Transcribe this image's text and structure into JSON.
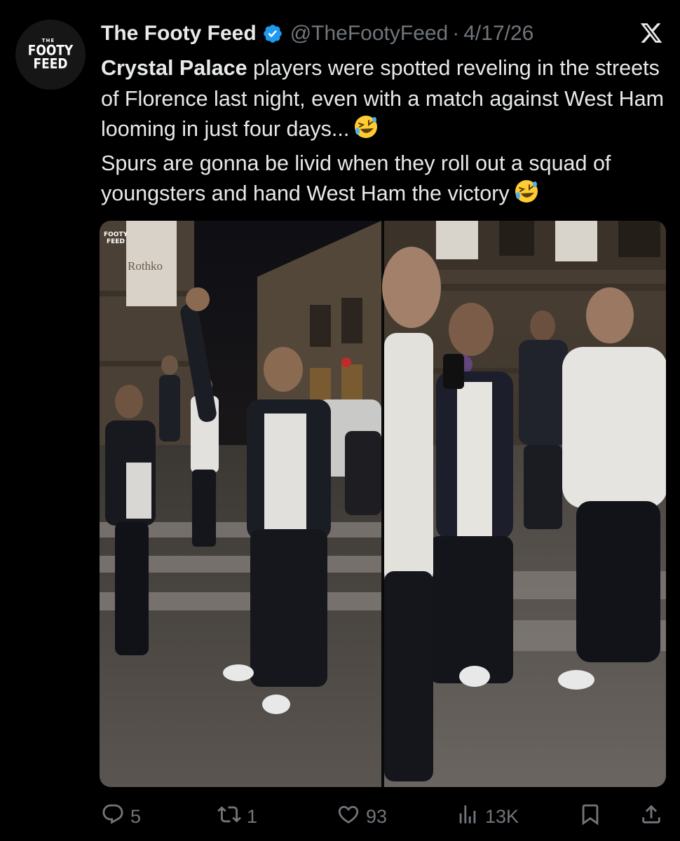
{
  "tweet": {
    "author_name": "The Footy Feed",
    "handle": "@TheFootyFeed",
    "separator": "·",
    "date": "4/17/26",
    "text_bold": "Crystal Palace",
    "text_lines": [
      " players were spotted reveling in the streets of Florence last night, even with a match against West Ham looming in just four days...",
      "Spurs are gonna be livid when they roll out a squad of youngsters and hand West Ham the victory"
    ]
  },
  "avatar": {
    "the": "THE",
    "line1": "FOOTY",
    "line2": "FEED"
  },
  "media": {
    "watermark_line1": "FOOTY",
    "watermark_line2": "FEED",
    "banner_text": "Rothko"
  },
  "actions": {
    "replies": "5",
    "reposts": "1",
    "likes": "93",
    "views": "13K"
  },
  "icons": {
    "verified": "verified-badge-icon",
    "x_logo": "x-logo-icon",
    "emoji": "rolling-on-floor-laughing-emoji",
    "reply": "reply-icon",
    "repost": "repost-icon",
    "like": "heart-icon",
    "views": "views-chart-icon",
    "bookmark": "bookmark-icon",
    "share": "share-icon"
  },
  "colors": {
    "background": "#000000",
    "text": "#e7e9ea",
    "muted": "#71767b",
    "verified_blue": "#1d9bf0"
  }
}
